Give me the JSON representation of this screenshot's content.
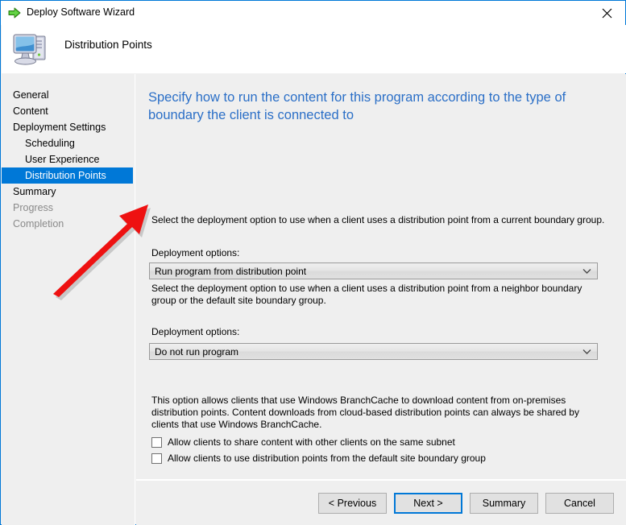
{
  "window": {
    "title": "Deploy Software Wizard",
    "title_icon": "green-right-arrow-icon",
    "close_icon": "close-icon",
    "border_color": "#0078d7"
  },
  "header": {
    "title": "Distribution Points",
    "icon": "computer-icon"
  },
  "sidebar": {
    "items": [
      {
        "label": "General",
        "indent": false,
        "state": "normal"
      },
      {
        "label": "Content",
        "indent": false,
        "state": "normal"
      },
      {
        "label": "Deployment Settings",
        "indent": false,
        "state": "normal"
      },
      {
        "label": "Scheduling",
        "indent": true,
        "state": "normal"
      },
      {
        "label": "User Experience",
        "indent": true,
        "state": "normal"
      },
      {
        "label": "Distribution Points",
        "indent": true,
        "state": "selected"
      },
      {
        "label": "Summary",
        "indent": false,
        "state": "normal"
      },
      {
        "label": "Progress",
        "indent": false,
        "state": "disabled"
      },
      {
        "label": "Completion",
        "indent": false,
        "state": "disabled"
      }
    ],
    "selected_color": "#0078d7"
  },
  "main": {
    "heading": "Specify how to run the content for this program according to the type of boundary the client is connected to",
    "heading_color": "#2b6fc7",
    "paragraph_current": "Select the deployment option to use when a client uses a distribution point from a current boundary group.",
    "deployment_options_label_1": "Deployment options:",
    "deployment_option_value_1": "Run program from distribution point",
    "paragraph_neighbor": "Select the deployment option to use when a client uses a distribution point from a neighbor boundary group or the default site boundary group.",
    "deployment_options_label_2": "Deployment options:",
    "deployment_option_value_2": "Do not run program",
    "paragraph_branchcache": "This option allows clients that use Windows BranchCache to download content from on-premises distribution points. Content downloads from cloud-based distribution points can always be shared by clients that use Windows BranchCache.",
    "checkbox_share_label": "Allow clients to share content with other clients on the same subnet",
    "checkbox_share_checked": false,
    "checkbox_default_site_label": "Allow clients to use distribution points from the default site boundary group",
    "checkbox_default_site_checked": false,
    "dropdown_icon": "chevron-down-icon"
  },
  "footer": {
    "previous_label": "< Previous",
    "next_label": "Next >",
    "summary_label": "Summary",
    "cancel_label": "Cancel",
    "default_button": "Next >"
  },
  "annotation": {
    "type": "red-arrow",
    "color": "#ee1111",
    "points_to": "deployment_option_value_1"
  }
}
